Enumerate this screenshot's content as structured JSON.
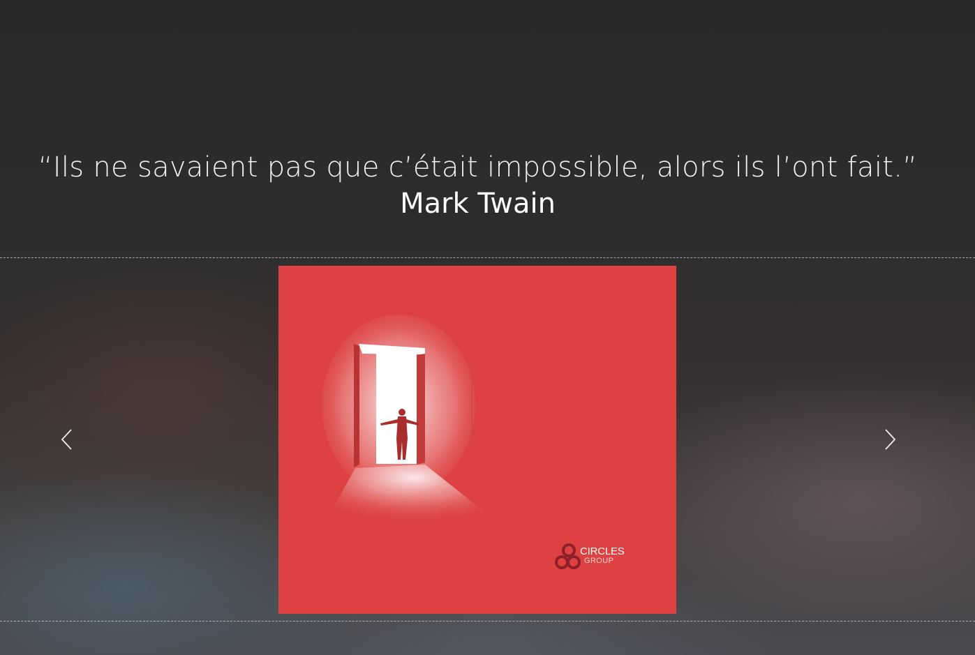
{
  "quote": {
    "text": "“Ils ne savaient pas que c’était impossible, alors ils l’ont fait.”",
    "author": "Mark Twain"
  },
  "slider": {
    "slide": {
      "logo": {
        "name_line": "CIRCLES",
        "sub_line": "GROUP"
      }
    },
    "prev_icon": "chevron-left-icon",
    "next_icon": "chevron-right-icon"
  },
  "colors": {
    "slide_background": "#dd4141",
    "logo_mark": "#8e1f2a",
    "text": "#ffffff"
  }
}
